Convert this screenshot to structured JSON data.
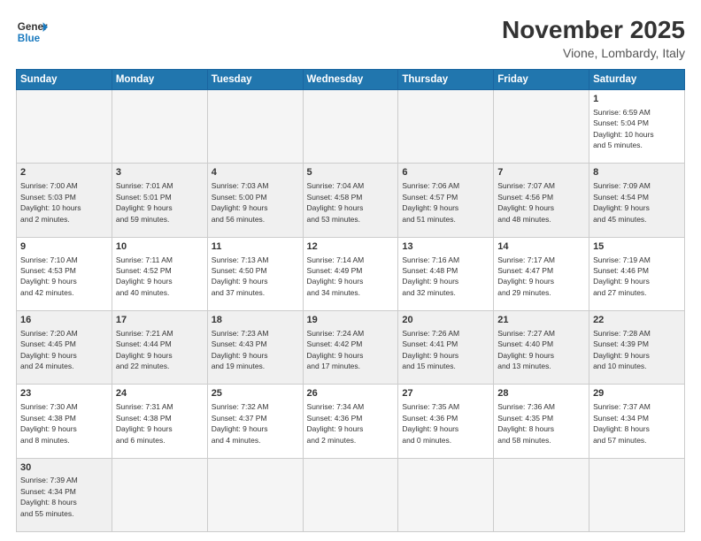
{
  "header": {
    "logo_general": "General",
    "logo_blue": "Blue",
    "month_title": "November 2025",
    "location": "Vione, Lombardy, Italy"
  },
  "weekdays": [
    "Sunday",
    "Monday",
    "Tuesday",
    "Wednesday",
    "Thursday",
    "Friday",
    "Saturday"
  ],
  "weeks": [
    [
      {
        "day": "",
        "info": ""
      },
      {
        "day": "",
        "info": ""
      },
      {
        "day": "",
        "info": ""
      },
      {
        "day": "",
        "info": ""
      },
      {
        "day": "",
        "info": ""
      },
      {
        "day": "",
        "info": ""
      },
      {
        "day": "1",
        "info": "Sunrise: 6:59 AM\nSunset: 5:04 PM\nDaylight: 10 hours\nand 5 minutes."
      }
    ],
    [
      {
        "day": "2",
        "info": "Sunrise: 7:00 AM\nSunset: 5:03 PM\nDaylight: 10 hours\nand 2 minutes."
      },
      {
        "day": "3",
        "info": "Sunrise: 7:01 AM\nSunset: 5:01 PM\nDaylight: 9 hours\nand 59 minutes."
      },
      {
        "day": "4",
        "info": "Sunrise: 7:03 AM\nSunset: 5:00 PM\nDaylight: 9 hours\nand 56 minutes."
      },
      {
        "day": "5",
        "info": "Sunrise: 7:04 AM\nSunset: 4:58 PM\nDaylight: 9 hours\nand 53 minutes."
      },
      {
        "day": "6",
        "info": "Sunrise: 7:06 AM\nSunset: 4:57 PM\nDaylight: 9 hours\nand 51 minutes."
      },
      {
        "day": "7",
        "info": "Sunrise: 7:07 AM\nSunset: 4:56 PM\nDaylight: 9 hours\nand 48 minutes."
      },
      {
        "day": "8",
        "info": "Sunrise: 7:09 AM\nSunset: 4:54 PM\nDaylight: 9 hours\nand 45 minutes."
      }
    ],
    [
      {
        "day": "9",
        "info": "Sunrise: 7:10 AM\nSunset: 4:53 PM\nDaylight: 9 hours\nand 42 minutes."
      },
      {
        "day": "10",
        "info": "Sunrise: 7:11 AM\nSunset: 4:52 PM\nDaylight: 9 hours\nand 40 minutes."
      },
      {
        "day": "11",
        "info": "Sunrise: 7:13 AM\nSunset: 4:50 PM\nDaylight: 9 hours\nand 37 minutes."
      },
      {
        "day": "12",
        "info": "Sunrise: 7:14 AM\nSunset: 4:49 PM\nDaylight: 9 hours\nand 34 minutes."
      },
      {
        "day": "13",
        "info": "Sunrise: 7:16 AM\nSunset: 4:48 PM\nDaylight: 9 hours\nand 32 minutes."
      },
      {
        "day": "14",
        "info": "Sunrise: 7:17 AM\nSunset: 4:47 PM\nDaylight: 9 hours\nand 29 minutes."
      },
      {
        "day": "15",
        "info": "Sunrise: 7:19 AM\nSunset: 4:46 PM\nDaylight: 9 hours\nand 27 minutes."
      }
    ],
    [
      {
        "day": "16",
        "info": "Sunrise: 7:20 AM\nSunset: 4:45 PM\nDaylight: 9 hours\nand 24 minutes."
      },
      {
        "day": "17",
        "info": "Sunrise: 7:21 AM\nSunset: 4:44 PM\nDaylight: 9 hours\nand 22 minutes."
      },
      {
        "day": "18",
        "info": "Sunrise: 7:23 AM\nSunset: 4:43 PM\nDaylight: 9 hours\nand 19 minutes."
      },
      {
        "day": "19",
        "info": "Sunrise: 7:24 AM\nSunset: 4:42 PM\nDaylight: 9 hours\nand 17 minutes."
      },
      {
        "day": "20",
        "info": "Sunrise: 7:26 AM\nSunset: 4:41 PM\nDaylight: 9 hours\nand 15 minutes."
      },
      {
        "day": "21",
        "info": "Sunrise: 7:27 AM\nSunset: 4:40 PM\nDaylight: 9 hours\nand 13 minutes."
      },
      {
        "day": "22",
        "info": "Sunrise: 7:28 AM\nSunset: 4:39 PM\nDaylight: 9 hours\nand 10 minutes."
      }
    ],
    [
      {
        "day": "23",
        "info": "Sunrise: 7:30 AM\nSunset: 4:38 PM\nDaylight: 9 hours\nand 8 minutes."
      },
      {
        "day": "24",
        "info": "Sunrise: 7:31 AM\nSunset: 4:38 PM\nDaylight: 9 hours\nand 6 minutes."
      },
      {
        "day": "25",
        "info": "Sunrise: 7:32 AM\nSunset: 4:37 PM\nDaylight: 9 hours\nand 4 minutes."
      },
      {
        "day": "26",
        "info": "Sunrise: 7:34 AM\nSunset: 4:36 PM\nDaylight: 9 hours\nand 2 minutes."
      },
      {
        "day": "27",
        "info": "Sunrise: 7:35 AM\nSunset: 4:36 PM\nDaylight: 9 hours\nand 0 minutes."
      },
      {
        "day": "28",
        "info": "Sunrise: 7:36 AM\nSunset: 4:35 PM\nDaylight: 8 hours\nand 58 minutes."
      },
      {
        "day": "29",
        "info": "Sunrise: 7:37 AM\nSunset: 4:34 PM\nDaylight: 8 hours\nand 57 minutes."
      }
    ],
    [
      {
        "day": "30",
        "info": "Sunrise: 7:39 AM\nSunset: 4:34 PM\nDaylight: 8 hours\nand 55 minutes."
      },
      {
        "day": "",
        "info": ""
      },
      {
        "day": "",
        "info": ""
      },
      {
        "day": "",
        "info": ""
      },
      {
        "day": "",
        "info": ""
      },
      {
        "day": "",
        "info": ""
      },
      {
        "day": "",
        "info": ""
      }
    ]
  ]
}
